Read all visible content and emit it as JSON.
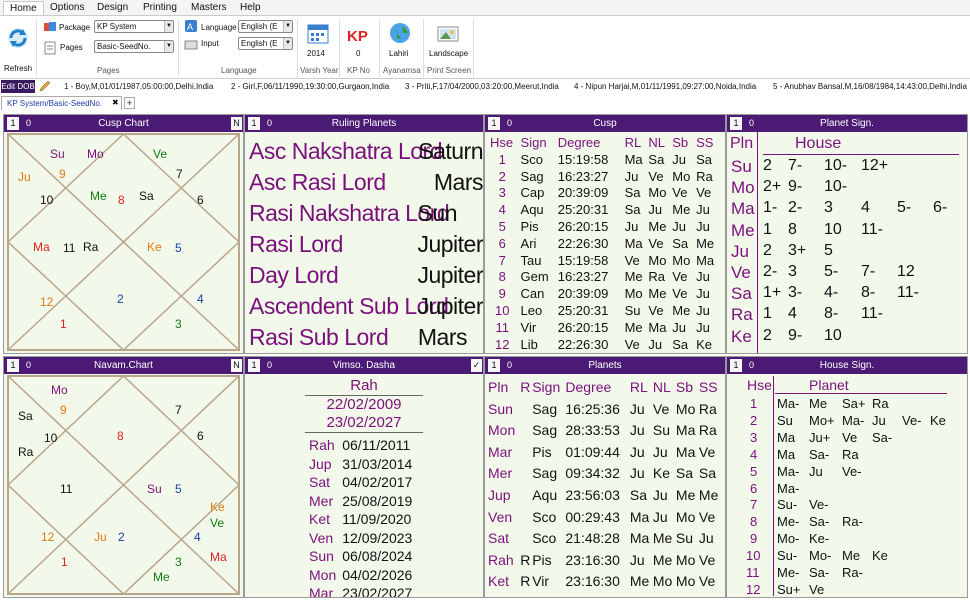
{
  "menu": {
    "items": [
      "Home",
      "Options",
      "Design",
      "Printing",
      "Masters",
      "Help"
    ]
  },
  "ribbon": {
    "refresh_label": "Refresh",
    "package_label": "Package",
    "package_value": "KP System",
    "pages_label": "Pages",
    "pages_value": "Basic-SeedNo.",
    "pages_group_title": "Pages",
    "language_label": "Language",
    "language_value": "English (E",
    "input_label": "Input",
    "input_value": "English (E",
    "language_group_title": "Language",
    "varsh_value": "2014",
    "varsh_title": "Varsh Year",
    "kp_value": "0",
    "kp_title": "KP No",
    "ayanamsa_value": "Lahiri",
    "ayanamsa_title": "Ayanamsa",
    "print_value": "Landscape",
    "print_title": "Print Screen"
  },
  "profiles": {
    "edit_dob_label": "Edit DOB",
    "items": [
      "1 - Boy,M,01/01/1987,05:00:00,Delhi,India",
      "2 - Girl,F,06/11/1990,19:30:00,Gurgaon,India",
      "3 - Priti,F,17/04/2000,03:20:00,Meerut,India",
      "4 - Nipun Harjai,M,01/11/1991,09:27:00,Noida,India",
      "5 - Anubhav Bansal,M,16/08/1984,14:43:00,Delhi,India"
    ]
  },
  "tab": {
    "label": "KP System/Basic-SeedNo.",
    "close": "✖",
    "add": "+"
  },
  "panels": {
    "one": "1",
    "zero": "0",
    "n": "N"
  },
  "cusp_chart": {
    "title": "Cusp Chart",
    "houses": [
      "1",
      "2",
      "3",
      "4",
      "5",
      "6",
      "7",
      "8",
      "9",
      "10",
      "11",
      "12"
    ],
    "planets": [
      "Su",
      "Mo",
      "Ve",
      "Ju",
      "Me",
      "Sa",
      "Ma",
      "Ra",
      "Ke"
    ]
  },
  "navam_chart": {
    "title": "Navam.Chart",
    "houses": [
      "1",
      "2",
      "3",
      "4",
      "5",
      "6",
      "7",
      "8",
      "9",
      "10",
      "11",
      "12"
    ],
    "planets": [
      "Mo",
      "Sa",
      "Ra",
      "Ju",
      "Su",
      "Ke",
      "Ve",
      "Ma",
      "Me"
    ]
  },
  "ruling_planets": {
    "title": "Ruling Planets",
    "rows": [
      {
        "label": "Asc Nakshatra Lord",
        "value": "Saturn"
      },
      {
        "label": "Asc Rasi Lord",
        "value": "Mars"
      },
      {
        "label": "Rasi Nakshatra Lord",
        "value": "Sun"
      },
      {
        "label": "Rasi Lord",
        "value": "Jupiter"
      },
      {
        "label": "Day Lord",
        "value": "Jupiter"
      },
      {
        "label": "Ascendent Sub Lord",
        "value": "Jupiter"
      },
      {
        "label": "Rasi Sub Lord",
        "value": "Mars"
      }
    ]
  },
  "cusp_table": {
    "title": "Cusp",
    "headers": [
      "Hse",
      "Sign",
      "Degree",
      "RL",
      "NL",
      "Sb",
      "SS"
    ],
    "rows": [
      [
        "1",
        "Sco",
        "15:19:58",
        "Ma",
        "Sa",
        "Ju",
        "Sa"
      ],
      [
        "2",
        "Sag",
        "16:23:27",
        "Ju",
        "Ve",
        "Mo",
        "Ra"
      ],
      [
        "3",
        "Cap",
        "20:39:09",
        "Sa",
        "Mo",
        "Ve",
        "Ve"
      ],
      [
        "4",
        "Aqu",
        "25:20:31",
        "Sa",
        "Ju",
        "Me",
        "Ju"
      ],
      [
        "5",
        "Pis",
        "26:20:15",
        "Ju",
        "Me",
        "Ju",
        "Ju"
      ],
      [
        "6",
        "Ari",
        "22:26:30",
        "Ma",
        "Ve",
        "Sa",
        "Me"
      ],
      [
        "7",
        "Tau",
        "15:19:58",
        "Ve",
        "Mo",
        "Mo",
        "Ma"
      ],
      [
        "8",
        "Gem",
        "16:23:27",
        "Me",
        "Ra",
        "Ve",
        "Ju"
      ],
      [
        "9",
        "Can",
        "20:39:09",
        "Mo",
        "Me",
        "Ve",
        "Ju"
      ],
      [
        "10",
        "Leo",
        "25:20:31",
        "Su",
        "Ve",
        "Me",
        "Ju"
      ],
      [
        "11",
        "Vir",
        "26:20:15",
        "Me",
        "Ma",
        "Ju",
        "Ju"
      ],
      [
        "12",
        "Lib",
        "22:26:30",
        "Ve",
        "Ju",
        "Sa",
        "Ke"
      ]
    ]
  },
  "planet_sign": {
    "title": "Planet Sign.",
    "headers": [
      "Pln",
      "House"
    ],
    "rows": [
      {
        "pln": "Su",
        "houses": [
          "2",
          "7-",
          "10-",
          "12+"
        ]
      },
      {
        "pln": "Mo",
        "houses": [
          "2+",
          "9-",
          "10-"
        ]
      },
      {
        "pln": "Ma",
        "houses": [
          "1-",
          "2-",
          "3",
          "4",
          "5-",
          "6-"
        ]
      },
      {
        "pln": "Me",
        "houses": [
          "1",
          "8",
          "10",
          "11-"
        ]
      },
      {
        "pln": "Ju",
        "houses": [
          "2",
          "3+",
          "5"
        ]
      },
      {
        "pln": "Ve",
        "houses": [
          "2-",
          "3",
          "5-",
          "7-",
          "12"
        ]
      },
      {
        "pln": "Sa",
        "houses": [
          "1+",
          "3-",
          "4-",
          "8-",
          "11-"
        ]
      },
      {
        "pln": "Ra",
        "houses": [
          "1",
          "4",
          "8-",
          "11-"
        ]
      },
      {
        "pln": "Ke",
        "houses": [
          "2",
          "9-",
          "10"
        ]
      }
    ]
  },
  "dasha": {
    "title": "Vimso. Dasha",
    "check": "✓",
    "lord": "Rah",
    "start": "22/02/2009",
    "end": "23/02/2027",
    "rows": [
      [
        "Rah",
        "06/11/2011"
      ],
      [
        "Jup",
        "31/03/2014"
      ],
      [
        "Sat",
        "04/02/2017"
      ],
      [
        "Mer",
        "25/08/2019"
      ],
      [
        "Ket",
        "11/09/2020"
      ],
      [
        "Ven",
        "12/09/2023"
      ],
      [
        "Sun",
        "06/08/2024"
      ],
      [
        "Mon",
        "04/02/2026"
      ],
      [
        "Mar",
        "23/02/2027"
      ]
    ]
  },
  "planets_table": {
    "title": "Planets",
    "headers": [
      "Pln",
      "R",
      "Sign",
      "Degree",
      "RL",
      "NL",
      "Sb",
      "SS"
    ],
    "rows": [
      [
        "Sun",
        "",
        "Sag",
        "16:25:36",
        "Ju",
        "Ve",
        "Mo",
        "Ra"
      ],
      [
        "Mon",
        "",
        "Sag",
        "28:33:53",
        "Ju",
        "Su",
        "Ma",
        "Ra"
      ],
      [
        "Mar",
        "",
        "Pis",
        "01:09:44",
        "Ju",
        "Ju",
        "Ma",
        "Ve"
      ],
      [
        "Mer",
        "",
        "Sag",
        "09:34:32",
        "Ju",
        "Ke",
        "Sa",
        "Sa"
      ],
      [
        "Jup",
        "",
        "Aqu",
        "23:56:03",
        "Sa",
        "Ju",
        "Me",
        "Me"
      ],
      [
        "Ven",
        "",
        "Sco",
        "00:29:43",
        "Ma",
        "Ju",
        "Mo",
        "Ve"
      ],
      [
        "Sat",
        "",
        "Sco",
        "21:48:28",
        "Ma",
        "Me",
        "Su",
        "Ju"
      ],
      [
        "Rah",
        "R",
        "Pis",
        "23:16:30",
        "Ju",
        "Me",
        "Mo",
        "Ve"
      ],
      [
        "Ket",
        "R",
        "Vir",
        "23:16:30",
        "Me",
        "Mo",
        "Mo",
        "Ve"
      ]
    ]
  },
  "house_sign": {
    "title": "House Sign.",
    "headers": [
      "Hse",
      "Planet"
    ],
    "rows": [
      {
        "hse": "1",
        "planets": [
          "Ma-",
          "Me",
          "Sa+",
          "Ra"
        ]
      },
      {
        "hse": "2",
        "planets": [
          "Su",
          "Mo+",
          "Ma-",
          "Ju",
          "Ve-",
          "Ke"
        ]
      },
      {
        "hse": "3",
        "planets": [
          "Ma",
          "Ju+",
          "Ve",
          "Sa-"
        ]
      },
      {
        "hse": "4",
        "planets": [
          "Ma",
          "Sa-",
          "Ra"
        ]
      },
      {
        "hse": "5",
        "planets": [
          "Ma-",
          "Ju",
          "Ve-"
        ]
      },
      {
        "hse": "6",
        "planets": [
          "Ma-"
        ]
      },
      {
        "hse": "7",
        "planets": [
          "Su-",
          "Ve-"
        ]
      },
      {
        "hse": "8",
        "planets": [
          "Me-",
          "Sa-",
          "Ra-"
        ]
      },
      {
        "hse": "9",
        "planets": [
          "Mo-",
          "Ke-"
        ]
      },
      {
        "hse": "10",
        "planets": [
          "Su-",
          "Mo-",
          "Me",
          "Ke"
        ]
      },
      {
        "hse": "11",
        "planets": [
          "Me-",
          "Sa-",
          "Ra-"
        ]
      },
      {
        "hse": "12",
        "planets": [
          "Su+",
          "Ve"
        ]
      }
    ]
  },
  "colors": {
    "header_purple": "#4b1a74",
    "panel_bg": "#f3f9ea",
    "label_purple": "#7a107c",
    "green": "#0d7a12"
  }
}
